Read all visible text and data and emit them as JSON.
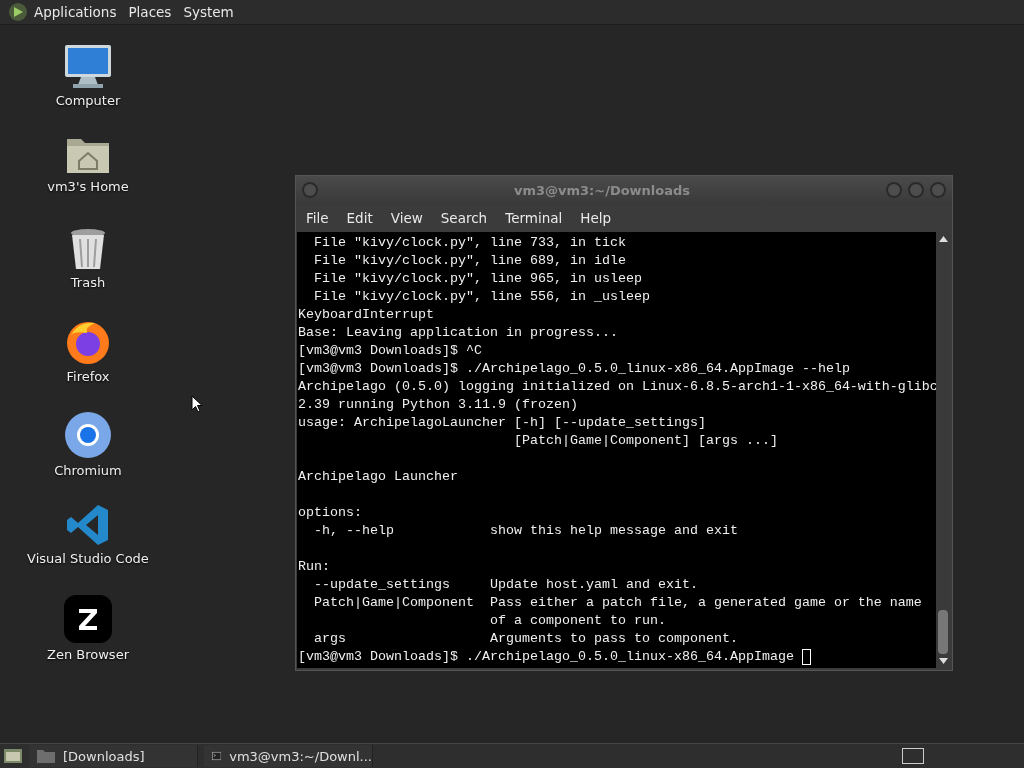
{
  "top_panel": {
    "menus": [
      "Applications",
      "Places",
      "System"
    ]
  },
  "desktop_icons": [
    {
      "label": "Computer",
      "kind": "computer"
    },
    {
      "label": "vm3's Home",
      "kind": "home"
    },
    {
      "label": "Trash",
      "kind": "trash"
    },
    {
      "label": "Firefox",
      "kind": "firefox"
    },
    {
      "label": "Chromium",
      "kind": "chromium"
    },
    {
      "label": "Visual Studio Code",
      "kind": "vscode"
    },
    {
      "label": "Zen Browser",
      "kind": "zen"
    }
  ],
  "terminal": {
    "title": "vm3@vm3:~/Downloads",
    "menu": [
      "File",
      "Edit",
      "View",
      "Search",
      "Terminal",
      "Help"
    ],
    "blocks": [
      {
        "lines": [
          "  File \"kivy/clock.py\", line 733, in tick",
          "  File \"kivy/clock.py\", line 689, in idle",
          "  File \"kivy/clock.py\", line 965, in usleep",
          "  File \"kivy/clock.py\", line 556, in _usleep",
          "KeyboardInterrupt",
          "Base: Leaving application in progress...",
          "[vm3@vm3 Downloads]$ ^C",
          "[vm3@vm3 Downloads]$ ./Archipelago_0.5.0_linux-x86_64.AppImage --help",
          "Archipelago (0.5.0) logging initialized on Linux-6.8.5-arch1-1-x86_64-with-glibc",
          "2.39 running Python 3.11.9 (frozen)",
          "usage: ArchipelagoLauncher [-h] [--update_settings]",
          "                           [Patch|Game|Component] [args ...]"
        ]
      },
      {
        "lines": [
          "Archipelago Launcher"
        ]
      },
      {
        "lines": [
          "options:",
          "  -h, --help            show this help message and exit"
        ]
      },
      {
        "lines": [
          "Run:",
          "  --update_settings     Update host.yaml and exit.",
          "  Patch|Game|Component  Pass either a patch file, a generated game or the name",
          "                        of a component to run.",
          "  args                  Arguments to pass to component.",
          "[vm3@vm3 Downloads]$ ./Archipelago_0.5.0_linux-x86_64.AppImage "
        ]
      }
    ],
    "cursor": true
  },
  "taskbar": {
    "items": [
      {
        "label": "[Downloads]",
        "kind": "folder"
      },
      {
        "label": "vm3@vm3:~/Downl...",
        "kind": "terminal"
      }
    ]
  }
}
